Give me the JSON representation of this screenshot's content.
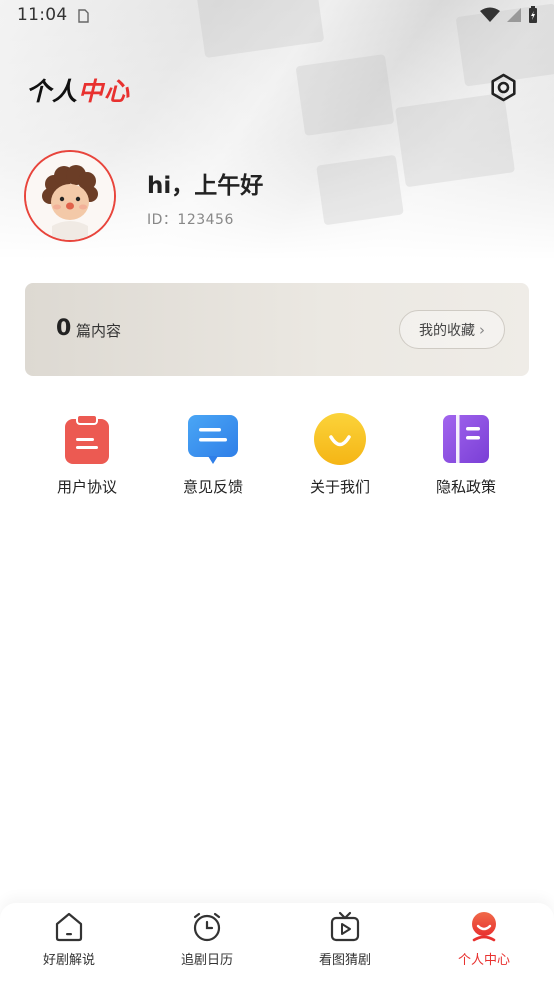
{
  "status_bar": {
    "time": "11:04"
  },
  "header": {
    "logo_part1": "个人",
    "logo_part2": "中心"
  },
  "profile": {
    "greeting": "hi，上午好",
    "user_id": "ID：123456"
  },
  "content_card": {
    "count": "0",
    "label": "篇内容",
    "favorites_button": "我的收藏"
  },
  "shortcuts": [
    {
      "label": "用户协议",
      "icon": "user-agreement-icon",
      "color": "#ec5a52"
    },
    {
      "label": "意见反馈",
      "icon": "feedback-icon",
      "color": "#3b8ff0"
    },
    {
      "label": "关于我们",
      "icon": "about-us-icon",
      "color": "#f7c221"
    },
    {
      "label": "隐私政策",
      "icon": "privacy-policy-icon",
      "color": "#8b4fe0"
    }
  ],
  "tab_bar": {
    "items": [
      {
        "label": "好剧解说",
        "icon": "home-icon",
        "active": false
      },
      {
        "label": "追剧日历",
        "icon": "alarm-clock-icon",
        "active": false
      },
      {
        "label": "看图猜剧",
        "icon": "tv-play-icon",
        "active": false
      },
      {
        "label": "个人中心",
        "icon": "profile-icon",
        "active": true
      }
    ]
  },
  "colors": {
    "accent": "#e8312f",
    "background": "#ffffff"
  }
}
